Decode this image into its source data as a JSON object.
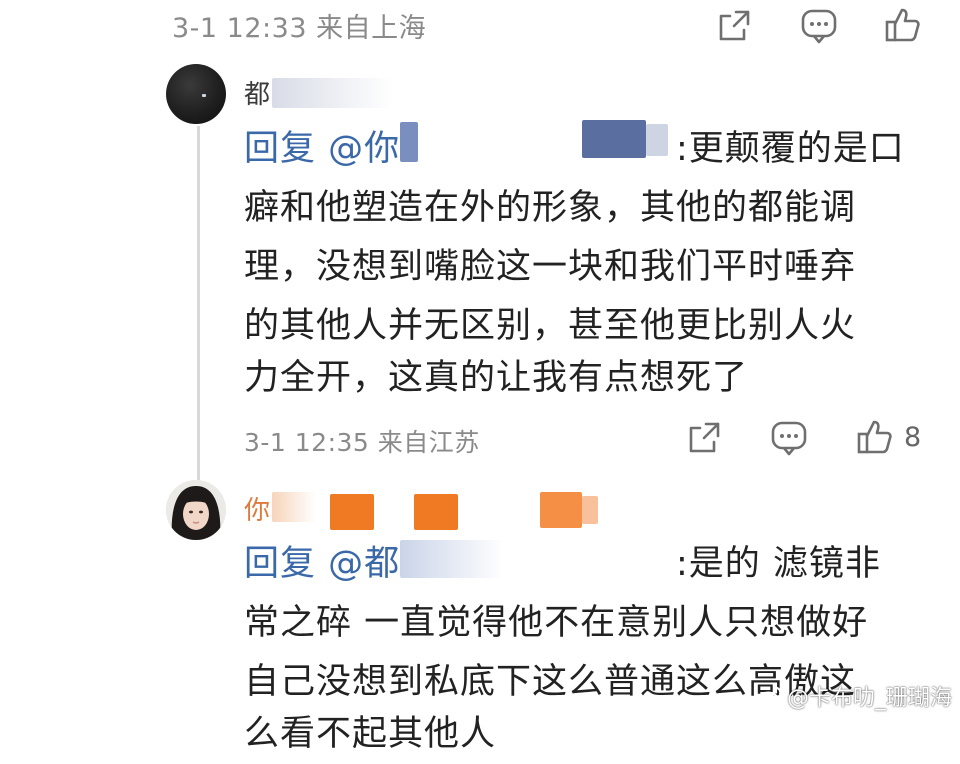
{
  "top_comment": {
    "meta": "3-1 12:33 来自上海"
  },
  "reply1": {
    "username": "都",
    "lines": [
      "回复 @你",
      ":更颠覆的是口",
      "癖和他塑造在外的形象，其他的都能调",
      "理，没想到嘴脸这一块和我们平时唾弃",
      "的其他人并无区别，甚至他更比别人火",
      "力全开，这真的让我有点想死了"
    ],
    "meta": "3-1 12:35 来自江苏",
    "like_count": "8"
  },
  "reply2": {
    "username": "你",
    "lines": [
      "回复 @都",
      ":是的 滤镜非",
      "常之碎 一直觉得他不在意别人只想做好",
      "自己没想到私底下这么普通这么高傲这",
      "么看不起其他人"
    ]
  },
  "watermark": {
    "text": "@卡布叻_珊瑚海"
  },
  "icons": [
    "share-icon",
    "comment-icon",
    "like-icon",
    "weibo-logo-icon"
  ],
  "colors": {
    "mention": "#3b68a8",
    "meta": "#8a8a8a",
    "highlight_orange": "#f07a24",
    "blur_blue": "#5a6fa0"
  }
}
